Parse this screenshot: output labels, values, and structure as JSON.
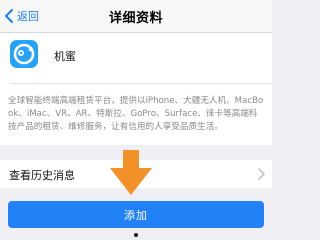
{
  "navbar": {
    "back_label": "返回",
    "title": "详细资料"
  },
  "app": {
    "name": "机蜜",
    "icon": "owl-logo-icon",
    "icon_color": "#27a3f5",
    "description": "全球智能终端高端租赁平台，提供以iPhone、大疆无人机、MacBook、iMac、VR、AR、特斯拉、GoPro、Surface、徕卡等高端科技产品的租赁、维修服务，让有信用的人享受品质生活。"
  },
  "history": {
    "label": "查看历史消息"
  },
  "actions": {
    "add_label": "添加",
    "accent": "#2281f6"
  },
  "annotation": {
    "arrow_color": "#f2902a"
  }
}
